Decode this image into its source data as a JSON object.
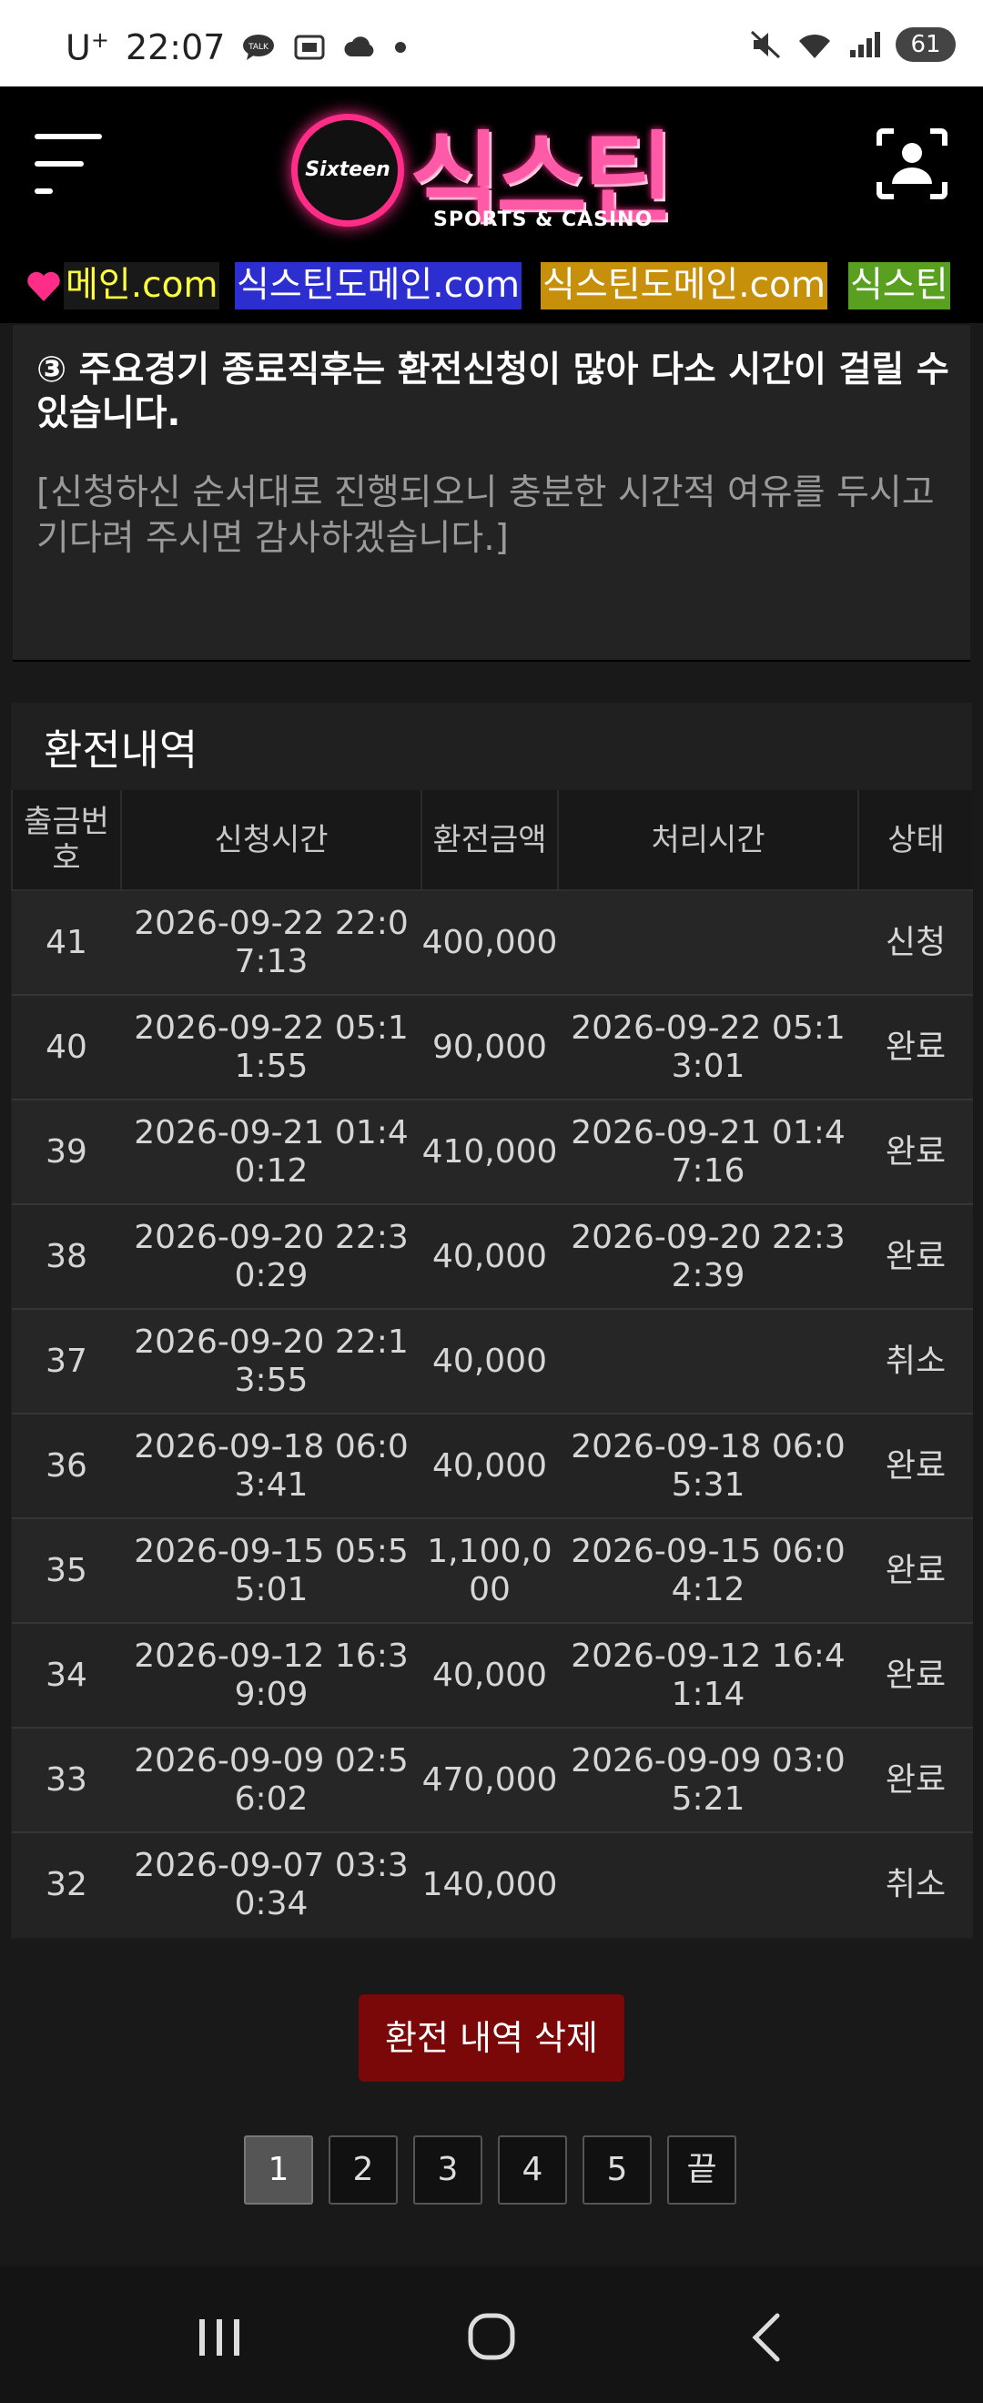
{
  "status_bar": {
    "carrier": "U",
    "carrier_sup": "+",
    "time": "22:07",
    "battery": "61"
  },
  "header": {
    "logo_badge": "Sixteen",
    "logo_name": "식스틴",
    "logo_sub": "SPORTS & CASINO"
  },
  "marquee": {
    "items": [
      "메인.com",
      "식스틴도메인.com",
      "식스틴도메인.com",
      "식스틴"
    ]
  },
  "notice": {
    "title": "③ 주요경기 종료직후는 환전신청이 많아 다소 시간이 걸릴 수 있습니다.",
    "subtitle": "[신청하신 순서대로 진행되오니 충분한 시간적 여유를 두시고 기다려 주시면 감사하겠습니다.]"
  },
  "history": {
    "title": "환전내역",
    "columns": [
      "출금번호",
      "신청시간",
      "환전금액",
      "처리시간",
      "상태"
    ],
    "rows": [
      {
        "no": "41",
        "requested": "2026-09-22 22:07:13",
        "amount": "400,000",
        "processed": "",
        "status": "신청"
      },
      {
        "no": "40",
        "requested": "2026-09-22 05:11:55",
        "amount": "90,000",
        "processed": "2026-09-22 05:13:01",
        "status": "완료"
      },
      {
        "no": "39",
        "requested": "2026-09-21 01:40:12",
        "amount": "410,000",
        "processed": "2026-09-21 01:47:16",
        "status": "완료"
      },
      {
        "no": "38",
        "requested": "2026-09-20 22:30:29",
        "amount": "40,000",
        "processed": "2026-09-20 22:32:39",
        "status": "완료"
      },
      {
        "no": "37",
        "requested": "2026-09-20 22:13:55",
        "amount": "40,000",
        "processed": "",
        "status": "취소"
      },
      {
        "no": "36",
        "requested": "2026-09-18 06:03:41",
        "amount": "40,000",
        "processed": "2026-09-18 06:05:31",
        "status": "완료"
      },
      {
        "no": "35",
        "requested": "2026-09-15 05:55:01",
        "amount": "1,100,000",
        "processed": "2026-09-15 06:04:12",
        "status": "완료"
      },
      {
        "no": "34",
        "requested": "2026-09-12 16:39:09",
        "amount": "40,000",
        "processed": "2026-09-12 16:41:14",
        "status": "완료"
      },
      {
        "no": "33",
        "requested": "2026-09-09 02:56:02",
        "amount": "470,000",
        "processed": "2026-09-09 03:05:21",
        "status": "완료"
      },
      {
        "no": "32",
        "requested": "2026-09-07 03:30:34",
        "amount": "140,000",
        "processed": "",
        "status": "취소"
      }
    ]
  },
  "delete_button": "환전 내역 삭제",
  "pagination": {
    "pages": [
      "1",
      "2",
      "3",
      "4",
      "5",
      "끝"
    ],
    "active": "1"
  },
  "icons": {
    "menu": "hamburger-menu-icon",
    "profile": "profile-scan-icon",
    "heart": "heart-icon",
    "nav_recent": "recent-apps-icon",
    "nav_home": "home-icon",
    "nav_back": "back-icon"
  },
  "colors": {
    "brand_pink": "#ff2d87",
    "delete_button": "#7a0808",
    "background": "#191919"
  }
}
